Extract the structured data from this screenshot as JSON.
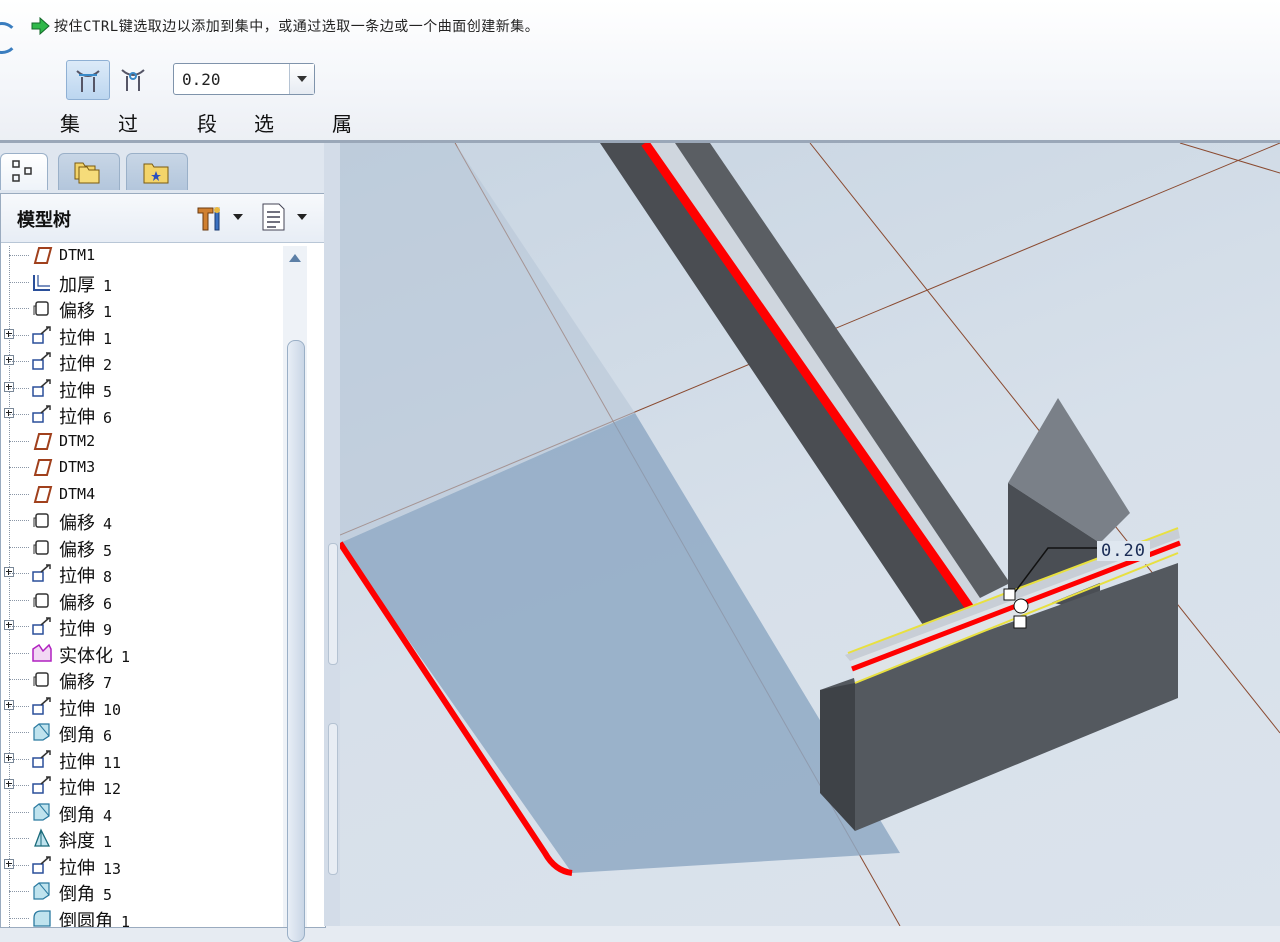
{
  "dashboard": {
    "prompt": "按住CTRL键选取边以添加到集中，或通过选取一条边或一个曲面创建新集。",
    "value": "0.20",
    "tabs": {
      "set": "集",
      "transition": "过渡",
      "segment": "段",
      "options": "选项",
      "properties": "属性"
    }
  },
  "model_tree": {
    "title": "模型树",
    "items": [
      {
        "name": "DTM1",
        "num": "",
        "icon": "datum-plane-icon",
        "expandable": false
      },
      {
        "name": "加厚",
        "num": "1",
        "icon": "thicken-icon",
        "expandable": false
      },
      {
        "name": "偏移",
        "num": "1",
        "icon": "offset-icon",
        "expandable": false
      },
      {
        "name": "拉伸",
        "num": "1",
        "icon": "extrude-icon",
        "expandable": true
      },
      {
        "name": "拉伸",
        "num": "2",
        "icon": "extrude-icon",
        "expandable": true
      },
      {
        "name": "拉伸",
        "num": "5",
        "icon": "extrude-icon",
        "expandable": true
      },
      {
        "name": "拉伸",
        "num": "6",
        "icon": "extrude-icon",
        "expandable": true
      },
      {
        "name": "DTM2",
        "num": "",
        "icon": "datum-plane-icon",
        "expandable": false
      },
      {
        "name": "DTM3",
        "num": "",
        "icon": "datum-plane-icon",
        "expandable": false
      },
      {
        "name": "DTM4",
        "num": "",
        "icon": "datum-plane-icon",
        "expandable": false
      },
      {
        "name": "偏移",
        "num": "4",
        "icon": "offset-icon",
        "expandable": false
      },
      {
        "name": "偏移",
        "num": "5",
        "icon": "offset-icon",
        "expandable": false
      },
      {
        "name": "拉伸",
        "num": "8",
        "icon": "extrude-icon",
        "expandable": true
      },
      {
        "name": "偏移",
        "num": "6",
        "icon": "offset-icon",
        "expandable": false
      },
      {
        "name": "拉伸",
        "num": "9",
        "icon": "extrude-icon",
        "expandable": true
      },
      {
        "name": "实体化",
        "num": "1",
        "icon": "solidify-icon",
        "expandable": false
      },
      {
        "name": "偏移",
        "num": "7",
        "icon": "offset-icon",
        "expandable": false
      },
      {
        "name": "拉伸",
        "num": "10",
        "icon": "extrude-icon",
        "expandable": true
      },
      {
        "name": "倒角",
        "num": "6",
        "icon": "chamfer-icon",
        "expandable": false
      },
      {
        "name": "拉伸",
        "num": "11",
        "icon": "extrude-icon",
        "expandable": true
      },
      {
        "name": "拉伸",
        "num": "12",
        "icon": "extrude-icon",
        "expandable": true
      },
      {
        "name": "倒角",
        "num": "4",
        "icon": "chamfer-icon",
        "expandable": false
      },
      {
        "name": "斜度",
        "num": "1",
        "icon": "draft-icon",
        "expandable": false
      },
      {
        "name": "拉伸",
        "num": "13",
        "icon": "extrude-icon",
        "expandable": true
      },
      {
        "name": "倒角",
        "num": "5",
        "icon": "chamfer-icon",
        "expandable": false
      },
      {
        "name": "倒圆角",
        "num": "1",
        "icon": "round-icon",
        "expandable": false
      }
    ]
  },
  "graphics": {
    "dimension_value": "0.20",
    "colors": {
      "selected_edge": "#ff0000",
      "preview_edge": "#e8e040",
      "datum_line": "#8a4a30"
    }
  }
}
